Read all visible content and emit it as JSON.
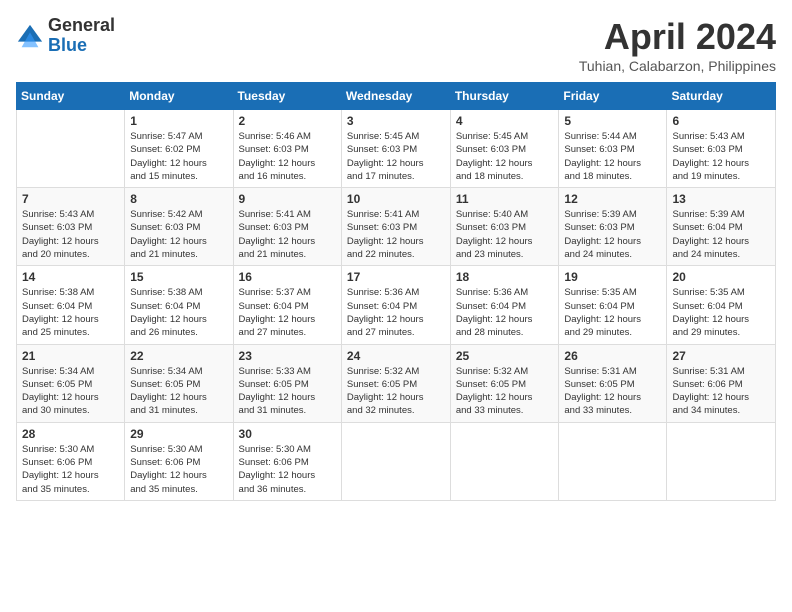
{
  "header": {
    "logo": {
      "general": "General",
      "blue": "Blue"
    },
    "month_title": "April 2024",
    "subtitle": "Tuhian, Calabarzon, Philippines"
  },
  "calendar": {
    "days_of_week": [
      "Sunday",
      "Monday",
      "Tuesday",
      "Wednesday",
      "Thursday",
      "Friday",
      "Saturday"
    ],
    "weeks": [
      [
        {
          "day": "",
          "info": ""
        },
        {
          "day": "1",
          "info": "Sunrise: 5:47 AM\nSunset: 6:02 PM\nDaylight: 12 hours\nand 15 minutes."
        },
        {
          "day": "2",
          "info": "Sunrise: 5:46 AM\nSunset: 6:03 PM\nDaylight: 12 hours\nand 16 minutes."
        },
        {
          "day": "3",
          "info": "Sunrise: 5:45 AM\nSunset: 6:03 PM\nDaylight: 12 hours\nand 17 minutes."
        },
        {
          "day": "4",
          "info": "Sunrise: 5:45 AM\nSunset: 6:03 PM\nDaylight: 12 hours\nand 18 minutes."
        },
        {
          "day": "5",
          "info": "Sunrise: 5:44 AM\nSunset: 6:03 PM\nDaylight: 12 hours\nand 18 minutes."
        },
        {
          "day": "6",
          "info": "Sunrise: 5:43 AM\nSunset: 6:03 PM\nDaylight: 12 hours\nand 19 minutes."
        }
      ],
      [
        {
          "day": "7",
          "info": "Sunrise: 5:43 AM\nSunset: 6:03 PM\nDaylight: 12 hours\nand 20 minutes."
        },
        {
          "day": "8",
          "info": "Sunrise: 5:42 AM\nSunset: 6:03 PM\nDaylight: 12 hours\nand 21 minutes."
        },
        {
          "day": "9",
          "info": "Sunrise: 5:41 AM\nSunset: 6:03 PM\nDaylight: 12 hours\nand 21 minutes."
        },
        {
          "day": "10",
          "info": "Sunrise: 5:41 AM\nSunset: 6:03 PM\nDaylight: 12 hours\nand 22 minutes."
        },
        {
          "day": "11",
          "info": "Sunrise: 5:40 AM\nSunset: 6:03 PM\nDaylight: 12 hours\nand 23 minutes."
        },
        {
          "day": "12",
          "info": "Sunrise: 5:39 AM\nSunset: 6:03 PM\nDaylight: 12 hours\nand 24 minutes."
        },
        {
          "day": "13",
          "info": "Sunrise: 5:39 AM\nSunset: 6:04 PM\nDaylight: 12 hours\nand 24 minutes."
        }
      ],
      [
        {
          "day": "14",
          "info": "Sunrise: 5:38 AM\nSunset: 6:04 PM\nDaylight: 12 hours\nand 25 minutes."
        },
        {
          "day": "15",
          "info": "Sunrise: 5:38 AM\nSunset: 6:04 PM\nDaylight: 12 hours\nand 26 minutes."
        },
        {
          "day": "16",
          "info": "Sunrise: 5:37 AM\nSunset: 6:04 PM\nDaylight: 12 hours\nand 27 minutes."
        },
        {
          "day": "17",
          "info": "Sunrise: 5:36 AM\nSunset: 6:04 PM\nDaylight: 12 hours\nand 27 minutes."
        },
        {
          "day": "18",
          "info": "Sunrise: 5:36 AM\nSunset: 6:04 PM\nDaylight: 12 hours\nand 28 minutes."
        },
        {
          "day": "19",
          "info": "Sunrise: 5:35 AM\nSunset: 6:04 PM\nDaylight: 12 hours\nand 29 minutes."
        },
        {
          "day": "20",
          "info": "Sunrise: 5:35 AM\nSunset: 6:04 PM\nDaylight: 12 hours\nand 29 minutes."
        }
      ],
      [
        {
          "day": "21",
          "info": "Sunrise: 5:34 AM\nSunset: 6:05 PM\nDaylight: 12 hours\nand 30 minutes."
        },
        {
          "day": "22",
          "info": "Sunrise: 5:34 AM\nSunset: 6:05 PM\nDaylight: 12 hours\nand 31 minutes."
        },
        {
          "day": "23",
          "info": "Sunrise: 5:33 AM\nSunset: 6:05 PM\nDaylight: 12 hours\nand 31 minutes."
        },
        {
          "day": "24",
          "info": "Sunrise: 5:32 AM\nSunset: 6:05 PM\nDaylight: 12 hours\nand 32 minutes."
        },
        {
          "day": "25",
          "info": "Sunrise: 5:32 AM\nSunset: 6:05 PM\nDaylight: 12 hours\nand 33 minutes."
        },
        {
          "day": "26",
          "info": "Sunrise: 5:31 AM\nSunset: 6:05 PM\nDaylight: 12 hours\nand 33 minutes."
        },
        {
          "day": "27",
          "info": "Sunrise: 5:31 AM\nSunset: 6:06 PM\nDaylight: 12 hours\nand 34 minutes."
        }
      ],
      [
        {
          "day": "28",
          "info": "Sunrise: 5:30 AM\nSunset: 6:06 PM\nDaylight: 12 hours\nand 35 minutes."
        },
        {
          "day": "29",
          "info": "Sunrise: 5:30 AM\nSunset: 6:06 PM\nDaylight: 12 hours\nand 35 minutes."
        },
        {
          "day": "30",
          "info": "Sunrise: 5:30 AM\nSunset: 6:06 PM\nDaylight: 12 hours\nand 36 minutes."
        },
        {
          "day": "",
          "info": ""
        },
        {
          "day": "",
          "info": ""
        },
        {
          "day": "",
          "info": ""
        },
        {
          "day": "",
          "info": ""
        }
      ]
    ]
  }
}
